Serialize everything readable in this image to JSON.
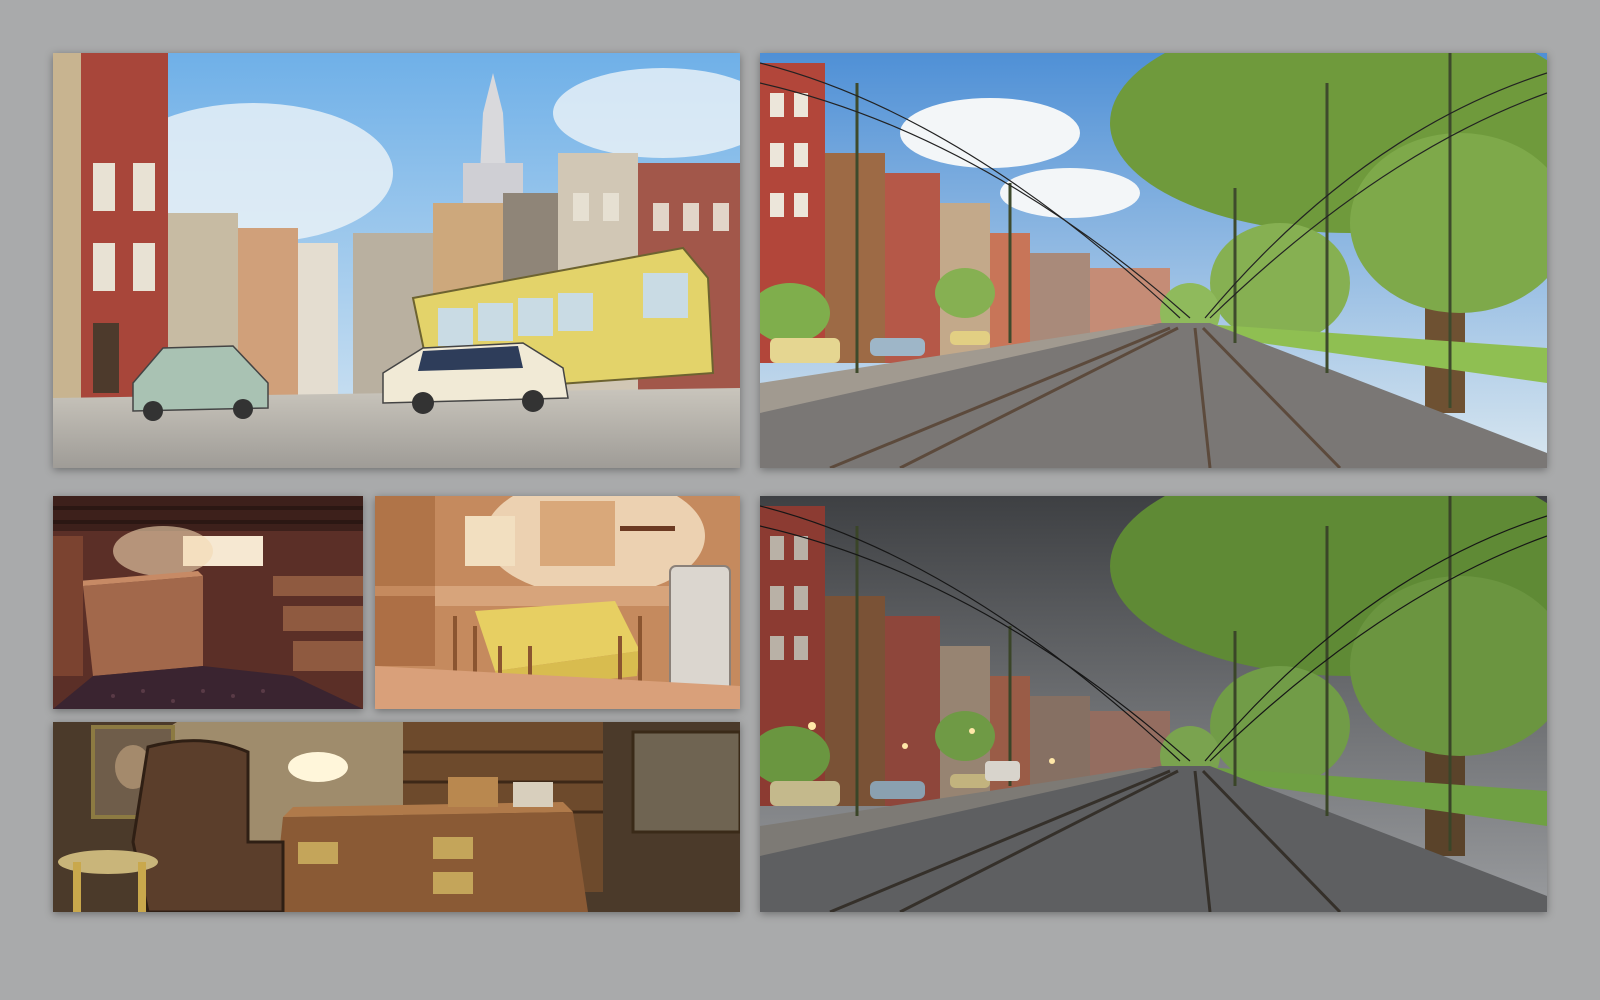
{
  "gallery": {
    "background_color": "#a9aaab",
    "panels": [
      {
        "id": "street-day-panel",
        "icon": "city-street-with-yellow-tram-and-vintage-cars"
      },
      {
        "id": "tram-avenue-sunny-panel",
        "icon": "tree-lined-avenue-with-tram-tracks-sunny"
      },
      {
        "id": "bar-interior-panel",
        "icon": "wood-panelled-bar-interior"
      },
      {
        "id": "kitchen-interior-panel",
        "icon": "retro-kitchen-with-yellow-tablecloth"
      },
      {
        "id": "study-interior-panel",
        "icon": "study-with-leather-armchair-and-desk"
      },
      {
        "id": "tram-avenue-rain-panel",
        "icon": "tree-lined-avenue-with-tram-tracks-rainy"
      }
    ],
    "colors": {
      "sky_day": "#7fb6e6",
      "sky_storm": "#4d4f52",
      "tram_yellow": "#e3d36a",
      "brick_red": "#a8463a",
      "foliage": "#6f9a3c",
      "wood": "#8a5a35",
      "tablecloth": "#e7cf62"
    }
  }
}
